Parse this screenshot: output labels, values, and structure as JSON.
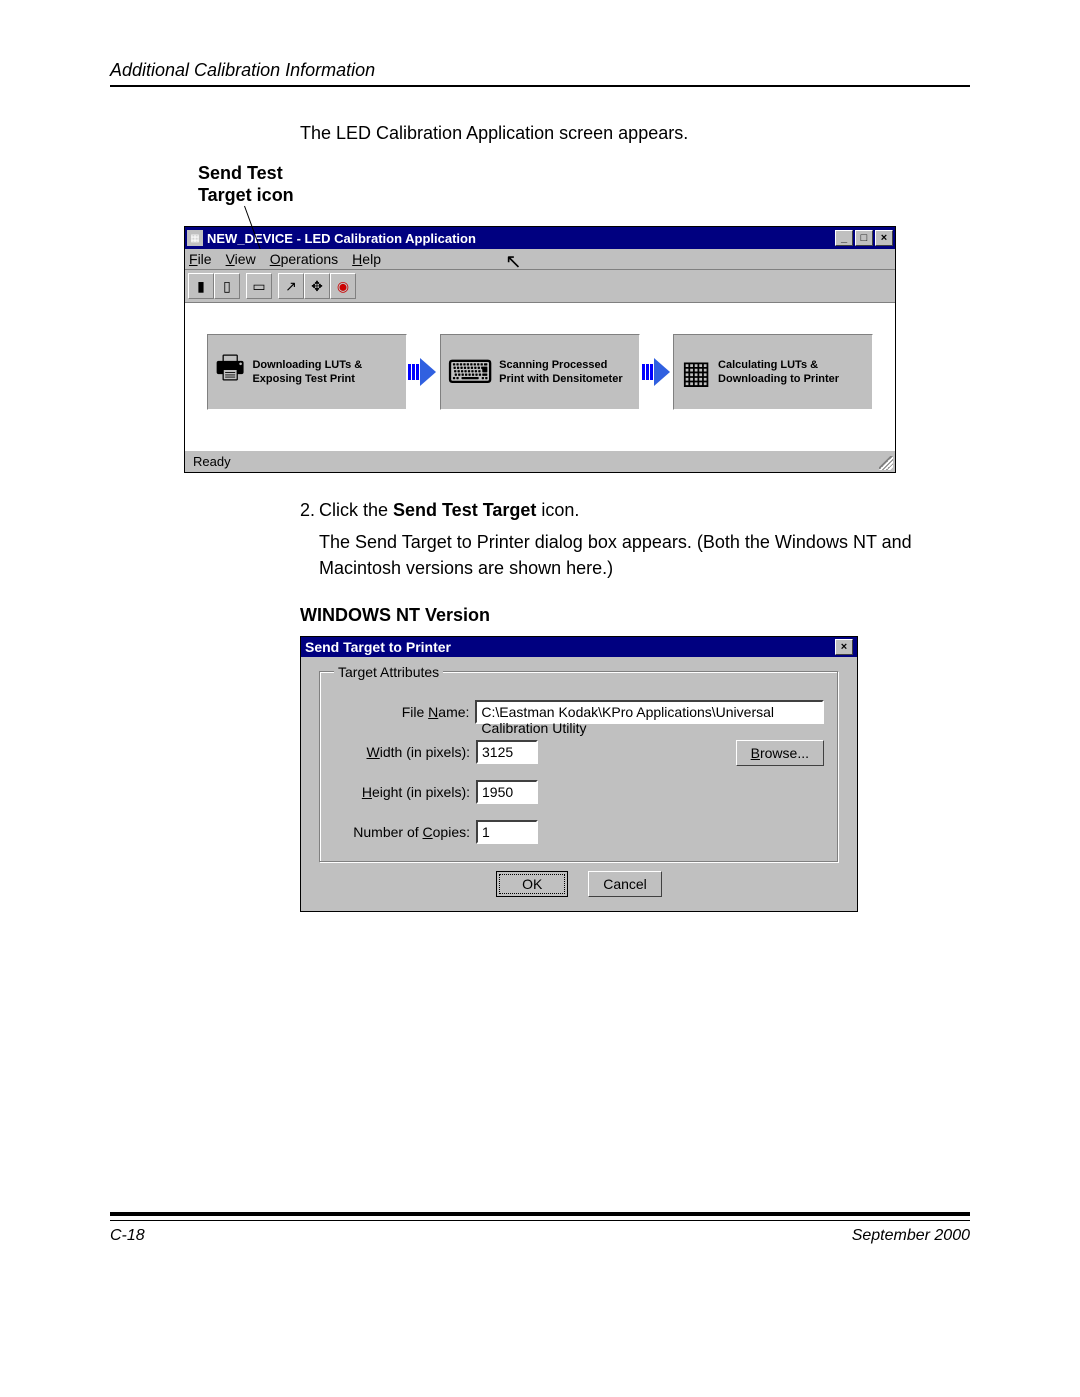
{
  "header": "Additional Calibration Information",
  "intro": "The LED Calibration Application screen appears.",
  "callout_label_l1": "Send Test",
  "callout_label_l2": "Target icon",
  "app": {
    "title": "NEW_DEVICE - LED Calibration Application",
    "menus": {
      "file": "File",
      "view": "View",
      "ops": "Operations",
      "help": "Help"
    },
    "steps": {
      "s1": "Downloading LUTs & Exposing Test Print",
      "s2": "Scanning Processed Print with Densitometer",
      "s3": "Calculating LUTs & Downloading to Printer"
    },
    "status": "Ready"
  },
  "instr": {
    "num": "2.",
    "line1a": "Click the ",
    "line1b": "Send Test Target",
    "line1c": " icon.",
    "line2": "The Send Target to Printer dialog box appears. (Both the Windows NT and Macintosh versions are shown here.)"
  },
  "section_heading": "WINDOWS NT Version",
  "dialog": {
    "title": "Send Target to Printer",
    "legend": "Target Attributes",
    "labels": {
      "file": "File Name:",
      "width": "Width (in pixels):",
      "height": "Height (in pixels):",
      "copies": "Number of Copies:"
    },
    "file_value": "C:\\Eastman Kodak\\KPro Applications\\Universal Calibration Utility",
    "width_value": "3125",
    "height_value": "1950",
    "copies_value": "1",
    "browse": "Browse...",
    "ok": "OK",
    "cancel": "Cancel"
  },
  "footer": {
    "left": "C-18",
    "right": "September 2000"
  }
}
